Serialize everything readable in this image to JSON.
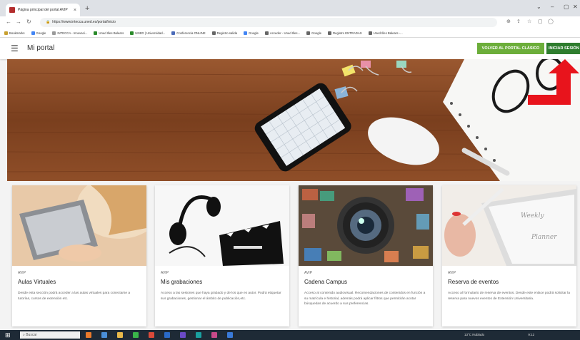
{
  "browser": {
    "tab_title": "Página principal del portal AVIP",
    "tab_close": "×",
    "new_tab": "+",
    "url": "https://www.intecca.uned.es/portal/inicio",
    "bookmarks": [
      "Bookmarks",
      "Google",
      "INTECCA - Innovaci...",
      "Uned Illes Balears",
      "UNED | Universidad...",
      "Conferencia ONLINE",
      "Registro salida",
      "Google",
      "Acceder - Uned Illes...",
      "Google",
      "Registro ENTRADAS",
      "Uned Illes Balears -..."
    ]
  },
  "header": {
    "menu_icon": "☰",
    "title": "Mi portal",
    "portal_button": "VOLVER AL PORTAL CLÁSICO",
    "login_button": "INICIAR SESIÓN"
  },
  "cards": [
    {
      "tag": "AVIP",
      "title": "Aulas Virtuales",
      "desc": "Desde esta sección podrá acceder a las aulas virtuales para conectarse a tutorías, cursos de extensión etc."
    },
    {
      "tag": "AVIP",
      "title": "Mis grabaciones",
      "desc": "Acceso a las sesiones que haya grabado y de los que es autor. Podrá etiquetar sus grabaciones, gestionar el ámbito de publicación,etc."
    },
    {
      "tag": "AVIP",
      "title": "Cadena Campus",
      "desc": "Acceso al contenido audiovisual. Recomendaciones de contenidos en función a su matrícula e historial, además podrá aplicar filtros que permitirán acotar búsquedas de acuerdo a sus preferencias."
    },
    {
      "tag": "AVIP",
      "title": "Reserva de eventos",
      "desc": "Acceso al formulario de reserva de eventos. Desde este enlace podrá solicitar la reserva para nuevos eventos de Extensión Universitaria."
    }
  ],
  "taskbar": {
    "search": "Buscar",
    "weather": "13°C  Nublado",
    "clock": "9:12"
  },
  "colors": {
    "portal_green": "#6cae3a",
    "login_green": "#2e7d2e",
    "arrow_red": "#e8141c",
    "wood": "#8a4a25"
  }
}
